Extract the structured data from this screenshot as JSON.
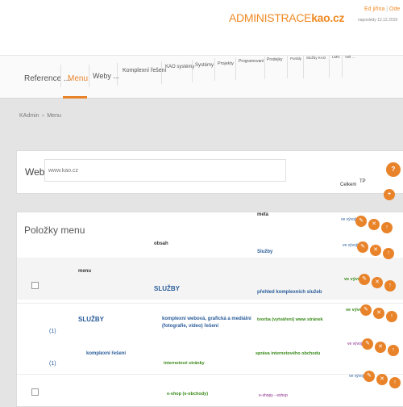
{
  "header": {
    "logo_pre": "ADMINISTRACE",
    "logo_brand": "kao.cz",
    "user_name": "Ed jiřina",
    "user_action": "Ode",
    "user_sub": "naposledy 12.12.2019"
  },
  "tabs": [
    {
      "label": "Reference ...",
      "active": false
    },
    {
      "label": "Menu",
      "active": true
    },
    {
      "label": "Weby ...",
      "active": false
    },
    {
      "label": "Komplexní řešení",
      "active": false
    },
    {
      "label": "KAO systémy",
      "active": false
    },
    {
      "label": "Systémy",
      "active": false
    },
    {
      "label": "Projekty",
      "active": false
    },
    {
      "label": "Programovaní",
      "active": false
    },
    {
      "label": "Prodejky",
      "active": false
    },
    {
      "label": "Portály",
      "active": false
    },
    {
      "label": "Služby KAO",
      "active": false
    },
    {
      "label": "LMG",
      "active": false
    },
    {
      "label": "Velt ...",
      "active": false
    }
  ],
  "breadcrumb": {
    "root": "KAdmin",
    "separator": "»",
    "current": "Menu"
  },
  "web": {
    "label": "Web:",
    "value": "www.kao.cz",
    "help_icon": "?"
  },
  "right_cols": {
    "col1": "Celkem",
    "col2": "TP"
  },
  "items": {
    "title": "Položky menu",
    "meta_header": "meta",
    "menu_header": "menu",
    "obsah_header": "obsah",
    "meta_link": "Služby",
    "rows": [
      {
        "num": "",
        "menu": "SLUŽBY",
        "obsah": "SLUŽBY",
        "meta": "přehled komplexních služeb",
        "status": "ve vývoji"
      },
      {
        "num": "(1)",
        "menu": "SLUŽBY",
        "obsah": "komplexní webová, grafická a mediální (fotografie, video) řešení",
        "meta": "tvorba (vytváření) www stránek",
        "status": "ve vývoji"
      },
      {
        "num": "(1)",
        "menu": "komplexní řešení",
        "obsah": "internetové stránky",
        "meta": "správa internetového obchodu",
        "status": "ve vývoji"
      }
    ],
    "extra_green": "e-shop (e-obchody)",
    "extra_purple": "e-shopy - eshop"
  }
}
